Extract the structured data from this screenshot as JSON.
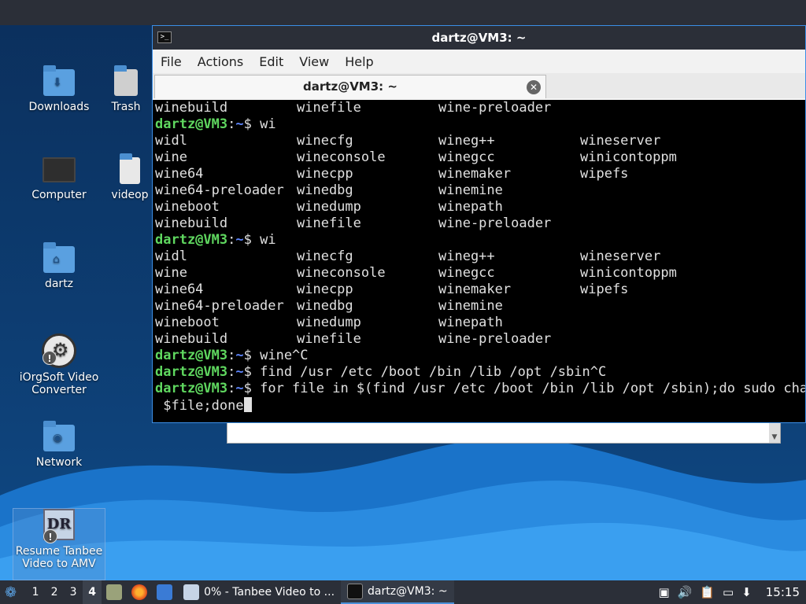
{
  "desktop": {
    "icons": [
      {
        "label": "Downloads",
        "icon": "folder-download-icon"
      },
      {
        "label": "Trash",
        "icon": "trash-icon"
      },
      {
        "label": "Computer",
        "icon": "computer-icon"
      },
      {
        "label": "videop",
        "icon": "file-icon"
      },
      {
        "label": "dartz",
        "icon": "home-folder-icon"
      },
      {
        "label": "iOrgSoft Video Converter",
        "icon": "film-reel-icon"
      },
      {
        "label": "Network",
        "icon": "network-folder-icon"
      },
      {
        "label": "Resume Tanbee Video to AMV",
        "icon": "tanbee-app-icon"
      }
    ]
  },
  "terminal": {
    "title": "dartz@VM3: ~",
    "menu": [
      "File",
      "Actions",
      "Edit",
      "View",
      "Help"
    ],
    "tab_title": "dartz@VM3: ~",
    "prompt_user": "dartz@VM3",
    "prompt_path": ":~$ ",
    "lines": [
      {
        "type": "cols",
        "cols": [
          "winebuild",
          "winefile",
          "wine-preloader",
          ""
        ]
      },
      {
        "type": "prompt",
        "cmd": "wi"
      },
      {
        "type": "cols",
        "cols": [
          "widl",
          "winecfg",
          "wineg++",
          "wineserver"
        ]
      },
      {
        "type": "cols",
        "cols": [
          "wine",
          "wineconsole",
          "winegcc",
          "winicontoppm"
        ]
      },
      {
        "type": "cols",
        "cols": [
          "wine64",
          "winecpp",
          "winemaker",
          "wipefs"
        ]
      },
      {
        "type": "cols",
        "cols": [
          "wine64-preloader",
          "winedbg",
          "winemine",
          ""
        ]
      },
      {
        "type": "cols",
        "cols": [
          "wineboot",
          "winedump",
          "winepath",
          ""
        ]
      },
      {
        "type": "cols",
        "cols": [
          "winebuild",
          "winefile",
          "wine-preloader",
          ""
        ]
      },
      {
        "type": "prompt",
        "cmd": "wi"
      },
      {
        "type": "cols",
        "cols": [
          "widl",
          "winecfg",
          "wineg++",
          "wineserver"
        ]
      },
      {
        "type": "cols",
        "cols": [
          "wine",
          "wineconsole",
          "winegcc",
          "winicontoppm"
        ]
      },
      {
        "type": "cols",
        "cols": [
          "wine64",
          "winecpp",
          "winemaker",
          "wipefs"
        ]
      },
      {
        "type": "cols",
        "cols": [
          "wine64-preloader",
          "winedbg",
          "winemine",
          ""
        ]
      },
      {
        "type": "cols",
        "cols": [
          "wineboot",
          "winedump",
          "winepath",
          ""
        ]
      },
      {
        "type": "cols",
        "cols": [
          "winebuild",
          "winefile",
          "wine-preloader",
          ""
        ]
      },
      {
        "type": "prompt",
        "cmd": "wine^C"
      },
      {
        "type": "prompt",
        "cmd": "find /usr /etc /boot /bin /lib /opt /sbin^C"
      },
      {
        "type": "prompt",
        "cmd": "for file in $(find /usr /etc /boot /bin /lib /opt /sbin);do sudo chatt"
      },
      {
        "type": "cont",
        "cmd": " $file;done"
      }
    ]
  },
  "taskbar": {
    "workspaces": [
      "1",
      "2",
      "3",
      "4"
    ],
    "active_workspace": "4",
    "tasks": [
      {
        "label": "0% - Tanbee Video to ...",
        "icon": "video-app-icon"
      },
      {
        "label": "dartz@VM3: ~",
        "icon": "terminal-icon"
      }
    ],
    "clock": "15:15"
  }
}
